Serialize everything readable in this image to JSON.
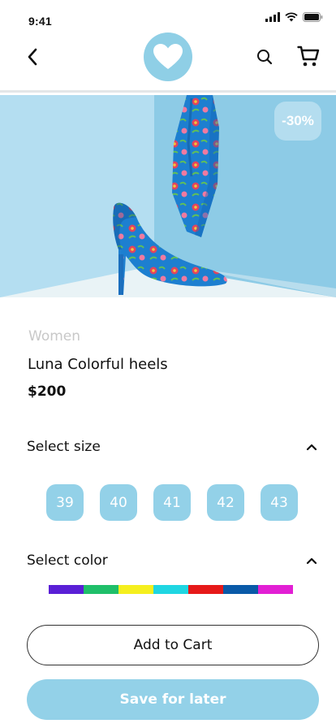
{
  "status_bar": {
    "time": "9:41"
  },
  "header": {
    "back_icon": "chevron-left-icon",
    "logo_icon": "heart-icon",
    "search_icon": "search-icon",
    "cart_icon": "cart-icon"
  },
  "product": {
    "discount": "-30%",
    "category": "Women",
    "name": "Luna Colorful heels",
    "price": "$200"
  },
  "size_section": {
    "title": "Select size",
    "sizes": [
      "39",
      "40",
      "41",
      "42",
      "43"
    ]
  },
  "color_section": {
    "title": "Select color",
    "colors": [
      "#5a1fd6",
      "#1fbf6a",
      "#f5ef1e",
      "#1fd6e2",
      "#e61919",
      "#0a5aa8",
      "#e21fd4"
    ]
  },
  "actions": {
    "add_to_cart": "Add to Cart",
    "save_for_later": "Save for later"
  },
  "colors": {
    "accent": "#93d1e8",
    "muted_text": "#c8c8c8"
  }
}
